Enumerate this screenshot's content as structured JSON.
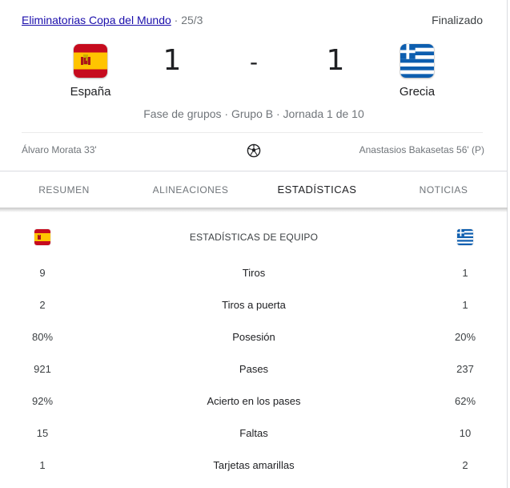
{
  "header": {
    "competition": "Eliminatorias Copa del Mundo",
    "date": "· 25/3",
    "status": "Finalizado"
  },
  "match": {
    "home": {
      "name": "España",
      "score": "1",
      "flag_icon": "spain-flag-icon"
    },
    "away": {
      "name": "Grecia",
      "score": "1",
      "flag_icon": "greece-flag-icon"
    },
    "separator": "-",
    "round_info": "Fase de grupos · Grupo B · Jornada 1 de 10"
  },
  "goals": {
    "home": "Álvaro Morata 33'",
    "away": "Anastasios Bakasetas 56' (P)",
    "icon": "soccer-ball-icon"
  },
  "tabs": [
    {
      "label": "RESUMEN",
      "active": false
    },
    {
      "label": "ALINEACIONES",
      "active": false
    },
    {
      "label": "ESTADÍSTICAS",
      "active": true
    },
    {
      "label": "NOTICIAS",
      "active": false
    }
  ],
  "stats": {
    "title": "ESTADÍSTICAS DE EQUIPO",
    "rows": [
      {
        "home": "9",
        "label": "Tiros",
        "away": "1"
      },
      {
        "home": "2",
        "label": "Tiros a puerta",
        "away": "1"
      },
      {
        "home": "80%",
        "label": "Posesión",
        "away": "20%"
      },
      {
        "home": "921",
        "label": "Pases",
        "away": "237"
      },
      {
        "home": "92%",
        "label": "Acierto en los pases",
        "away": "62%"
      },
      {
        "home": "15",
        "label": "Faltas",
        "away": "10"
      },
      {
        "home": "1",
        "label": "Tarjetas amarillas",
        "away": "2"
      }
    ]
  },
  "colors": {
    "link": "#1a0dab",
    "spain_red": "#c60b1e",
    "spain_yellow": "#ffc400",
    "greece_blue": "#0d5eaf"
  }
}
